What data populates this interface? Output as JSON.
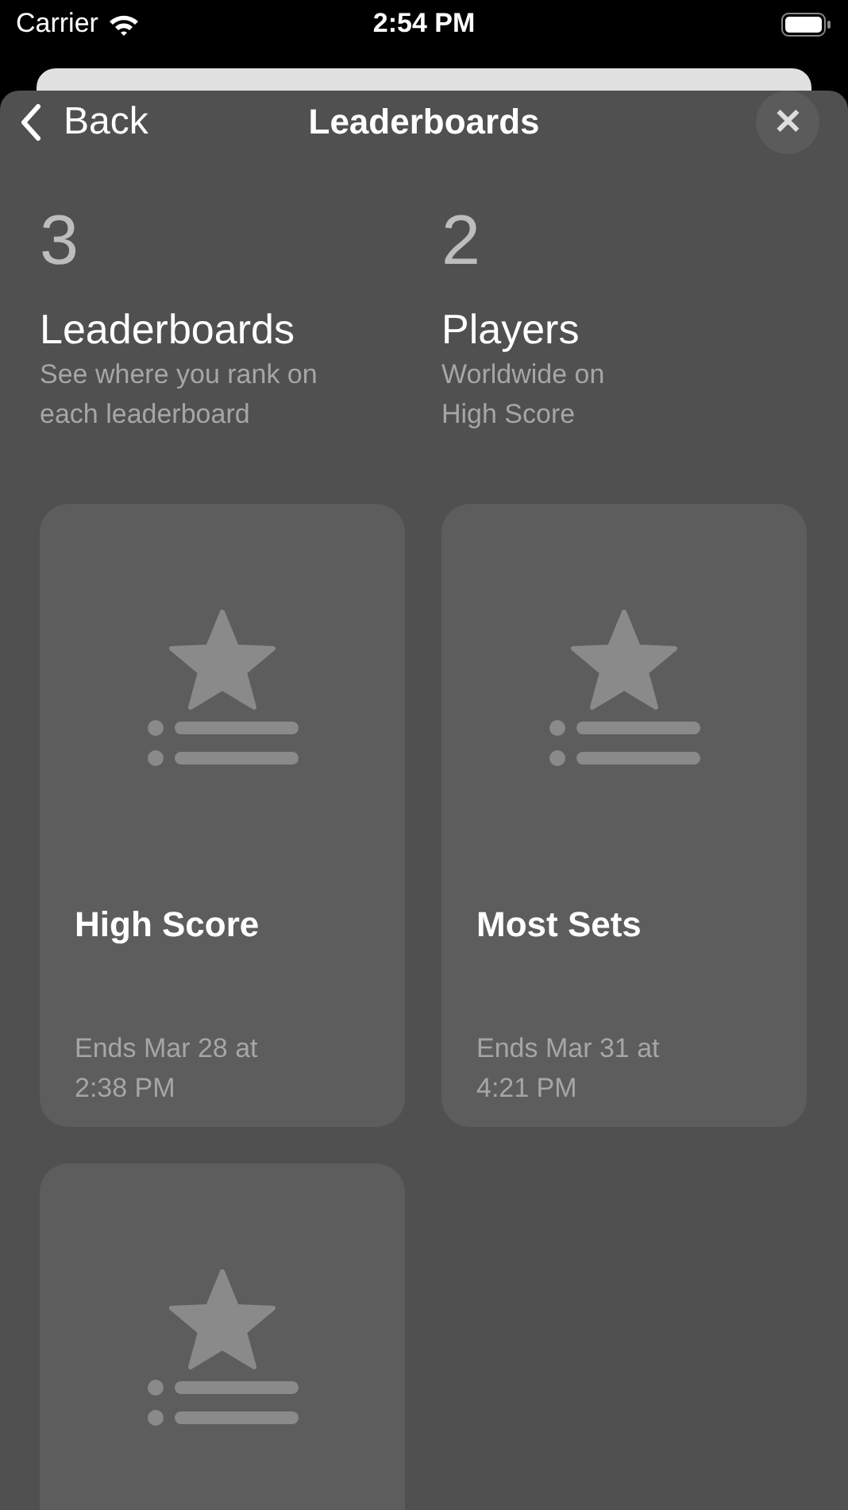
{
  "status_bar": {
    "carrier": "Carrier",
    "time": "2:54 PM"
  },
  "nav": {
    "back": "Back",
    "title": "Leaderboards",
    "close": "✕"
  },
  "stats": [
    {
      "value": "3",
      "label": "Leaderboards",
      "caption": "See where you rank on\neach leaderboard"
    },
    {
      "value": "2",
      "label": "Players",
      "caption": "Worldwide on\nHigh Score"
    }
  ],
  "cards": [
    {
      "kind": "leaderboard",
      "title": "High Score",
      "ends": "Ends Mar 28 at 2:38 PM"
    },
    {
      "kind": "leaderboard",
      "title": "Most Sets",
      "ends": "Ends Mar 31 at 4:21 PM"
    },
    {
      "kind": "leaderboard"
    }
  ]
}
